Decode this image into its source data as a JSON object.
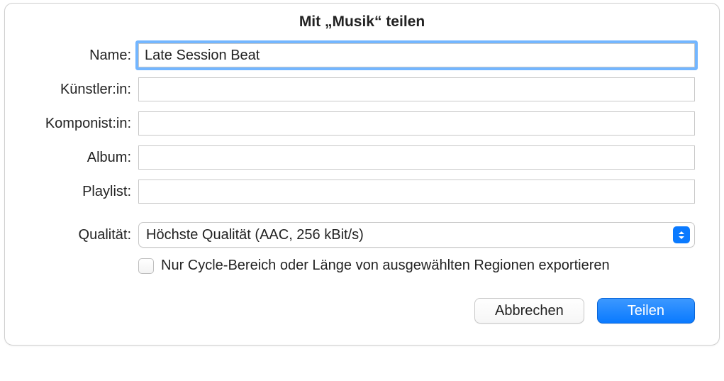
{
  "titlebar": {
    "title": "Mit „Musik“ teilen"
  },
  "form": {
    "name": {
      "label": "Name:",
      "value": "Late Session Beat"
    },
    "artist": {
      "label": "Künstler:in:",
      "value": ""
    },
    "composer": {
      "label": "Komponist:in:",
      "value": ""
    },
    "album": {
      "label": "Album:",
      "value": ""
    },
    "playlist": {
      "label": "Playlist:",
      "value": ""
    },
    "quality": {
      "label": "Qualität:",
      "selected": "Höchste Qualität (AAC, 256 kBit/s)"
    },
    "cycleExport": {
      "label": "Nur Cycle-Bereich oder Länge von ausgewählten Regionen exportieren",
      "checked": false
    }
  },
  "buttons": {
    "cancel": "Abbrechen",
    "share": "Teilen"
  }
}
